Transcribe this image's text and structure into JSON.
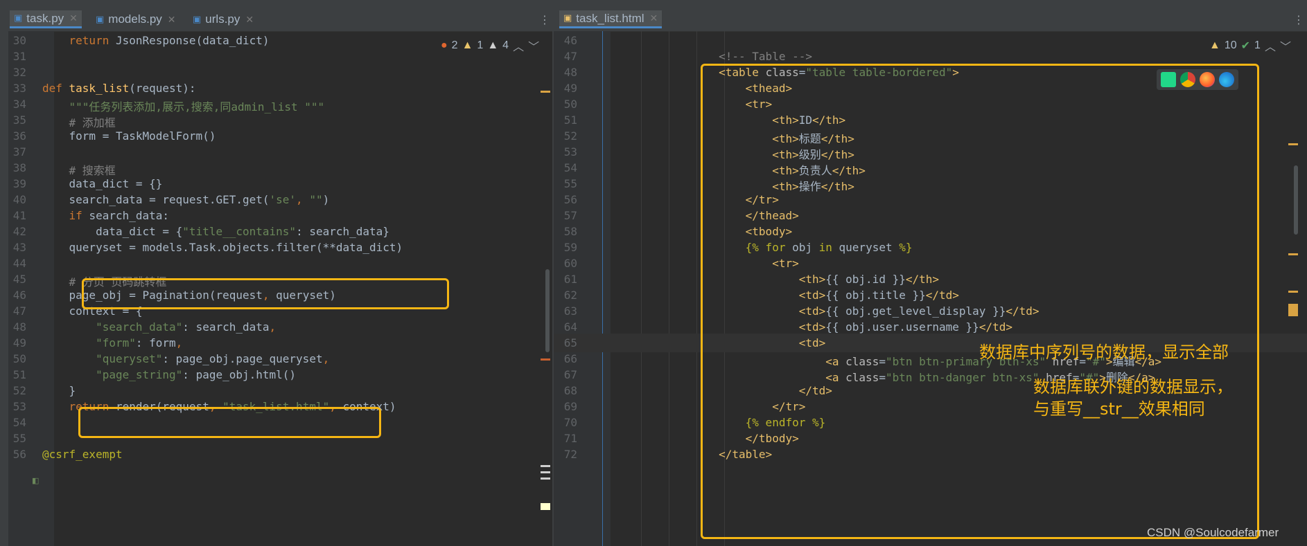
{
  "left_editor": {
    "tabs": [
      {
        "label": "task.py",
        "active": true,
        "icon": "python-file-icon"
      },
      {
        "label": "models.py",
        "active": false,
        "icon": "python-file-icon"
      },
      {
        "label": "urls.py",
        "active": false,
        "icon": "python-file-icon"
      }
    ],
    "inspection": {
      "errors": "2",
      "warnings": "1",
      "weak_warnings": "4"
    },
    "lines": [
      {
        "n": "30",
        "tokens": [
          [
            "k",
            "    return "
          ],
          [
            "",
            "JsonResponse(data_dict)"
          ]
        ]
      },
      {
        "n": "31",
        "tokens": []
      },
      {
        "n": "32",
        "tokens": []
      },
      {
        "n": "33",
        "tokens": [
          [
            "k",
            "def "
          ],
          [
            "f",
            "task_list"
          ],
          [
            "",
            "(request):"
          ]
        ]
      },
      {
        "n": "34",
        "tokens": [
          [
            "s",
            "    \"\"\"任务列表添加,展示,搜索,同admin_list \"\"\""
          ]
        ]
      },
      {
        "n": "35",
        "tokens": [
          [
            "c",
            "    # 添加框"
          ]
        ]
      },
      {
        "n": "36",
        "tokens": [
          [
            "",
            "    form = TaskModelForm()"
          ]
        ]
      },
      {
        "n": "37",
        "tokens": []
      },
      {
        "n": "38",
        "tokens": [
          [
            "c",
            "    # 搜索框"
          ]
        ]
      },
      {
        "n": "39",
        "tokens": [
          [
            "",
            "    data_dict = {}"
          ]
        ]
      },
      {
        "n": "40",
        "tokens": [
          [
            "",
            "    search_data = request.GET.get("
          ],
          [
            "s",
            "'se'"
          ],
          [
            "k",
            ", "
          ],
          [
            "s",
            "\"\""
          ],
          [
            "",
            ")"
          ]
        ]
      },
      {
        "n": "41",
        "tokens": [
          [
            "k",
            "    if "
          ],
          [
            "",
            "search_data:"
          ]
        ]
      },
      {
        "n": "42",
        "tokens": [
          [
            "",
            "        data_dict = {"
          ],
          [
            "s",
            "\"title__contains\""
          ],
          [
            "",
            ": search_data}"
          ]
        ]
      },
      {
        "n": "43",
        "tokens": [
          [
            "",
            "    queryset = models.Task.objects.filter(**data_dict)"
          ]
        ]
      },
      {
        "n": "44",
        "tokens": []
      },
      {
        "n": "45",
        "tokens": [
          [
            "c",
            "    # 分页 页码跳转框"
          ]
        ]
      },
      {
        "n": "46",
        "tokens": [
          [
            "",
            "    page_obj = Pagination(request"
          ],
          [
            "k",
            ", "
          ],
          [
            "",
            "queryset)"
          ]
        ]
      },
      {
        "n": "47",
        "tokens": [
          [
            "",
            "    context = {"
          ]
        ]
      },
      {
        "n": "48",
        "tokens": [
          [
            "s",
            "        \"search_data\""
          ],
          [
            "",
            ": search_data"
          ],
          [
            "k",
            ","
          ]
        ]
      },
      {
        "n": "49",
        "tokens": [
          [
            "s",
            "        \"form\""
          ],
          [
            "",
            ": form"
          ],
          [
            "k",
            ","
          ]
        ]
      },
      {
        "n": "50",
        "tokens": [
          [
            "s",
            "        \"queryset\""
          ],
          [
            "",
            ": page_obj.page_queryset"
          ],
          [
            "k",
            ","
          ]
        ]
      },
      {
        "n": "51",
        "tokens": [
          [
            "s",
            "        \"page_string\""
          ],
          [
            "",
            ": page_obj.html()"
          ]
        ]
      },
      {
        "n": "52",
        "tokens": [
          [
            "",
            "    }"
          ]
        ]
      },
      {
        "n": "53",
        "tokens": [
          [
            "k",
            "    return "
          ],
          [
            "",
            "render(request"
          ],
          [
            "k",
            ", "
          ],
          [
            "s",
            "\"task_list.html\""
          ],
          [
            "k",
            ", "
          ],
          [
            "",
            "context)"
          ]
        ]
      },
      {
        "n": "54",
        "tokens": []
      },
      {
        "n": "55",
        "tokens": []
      },
      {
        "n": "56",
        "tokens": [
          [
            "d",
            "@csrf_exempt"
          ]
        ]
      }
    ]
  },
  "right_editor": {
    "tabs": [
      {
        "label": "task_list.html",
        "active": true,
        "icon": "html-file-icon"
      }
    ],
    "inspection": {
      "warnings": "10",
      "typos": "1"
    },
    "lines": [
      {
        "n": "46",
        "tokens": []
      },
      {
        "n": "47",
        "tokens": [
          [
            "c",
            "                <!-- Table -->"
          ]
        ]
      },
      {
        "n": "48",
        "tokens": [
          [
            "tg",
            "                <table "
          ],
          [
            "at",
            "class"
          ],
          [
            "",
            "="
          ],
          [
            "av",
            "\"table table-bordered\""
          ],
          [
            "tg",
            ">"
          ]
        ]
      },
      {
        "n": "49",
        "tokens": [
          [
            "tg",
            "                    <thead>"
          ]
        ]
      },
      {
        "n": "50",
        "tokens": [
          [
            "tg",
            "                    <tr>"
          ]
        ]
      },
      {
        "n": "51",
        "tokens": [
          [
            "tg",
            "                        <th>"
          ],
          [
            "",
            "ID"
          ],
          [
            "tg",
            "</th>"
          ]
        ]
      },
      {
        "n": "52",
        "tokens": [
          [
            "tg",
            "                        <th>"
          ],
          [
            "",
            "标题"
          ],
          [
            "tg",
            "</th>"
          ]
        ]
      },
      {
        "n": "53",
        "tokens": [
          [
            "tg",
            "                        <th>"
          ],
          [
            "",
            "级别"
          ],
          [
            "tg",
            "</th>"
          ]
        ]
      },
      {
        "n": "54",
        "tokens": [
          [
            "tg",
            "                        <th>"
          ],
          [
            "",
            "负责人"
          ],
          [
            "tg",
            "</th>"
          ]
        ]
      },
      {
        "n": "55",
        "tokens": [
          [
            "tg",
            "                        <th>"
          ],
          [
            "",
            "操作"
          ],
          [
            "tg",
            "</th>"
          ]
        ]
      },
      {
        "n": "56",
        "tokens": [
          [
            "tg",
            "                    </tr>"
          ]
        ]
      },
      {
        "n": "57",
        "tokens": [
          [
            "tg",
            "                    </thead>"
          ]
        ]
      },
      {
        "n": "58",
        "tokens": [
          [
            "tg",
            "                    <tbody>"
          ]
        ]
      },
      {
        "n": "59",
        "tokens": [
          [
            "d",
            "                    {% for "
          ],
          [
            "",
            "obj "
          ],
          [
            "d",
            "in "
          ],
          [
            "",
            "queryset "
          ],
          [
            "d",
            "%}"
          ]
        ]
      },
      {
        "n": "60",
        "tokens": [
          [
            "tg",
            "                        <tr>"
          ]
        ]
      },
      {
        "n": "61",
        "tokens": [
          [
            "tg",
            "                            <th>"
          ],
          [
            "",
            "{{ obj.id }}"
          ],
          [
            "tg",
            "</th>"
          ]
        ]
      },
      {
        "n": "62",
        "tokens": [
          [
            "tg",
            "                            <td>"
          ],
          [
            "",
            "{{ obj.title }}"
          ],
          [
            "tg",
            "</td>"
          ]
        ]
      },
      {
        "n": "63",
        "tokens": [
          [
            "tg",
            "                            <td>"
          ],
          [
            "",
            "{{ obj.get_level_display }}"
          ],
          [
            "tg",
            "</td>"
          ]
        ]
      },
      {
        "n": "64",
        "tokens": [
          [
            "tg",
            "                            <td>"
          ],
          [
            "",
            "{{ obj.user.username }}"
          ],
          [
            "tg",
            "</td>"
          ]
        ]
      },
      {
        "n": "65",
        "tokens": [
          [
            "tg",
            "                            <td>"
          ]
        ]
      },
      {
        "n": "66",
        "tokens": [
          [
            "tg",
            "                                <a "
          ],
          [
            "at",
            "class"
          ],
          [
            "",
            "="
          ],
          [
            "av",
            "\"btn btn-primary btn-xs\" "
          ],
          [
            "at",
            "href"
          ],
          [
            "",
            "="
          ],
          [
            "av",
            "\"#\""
          ],
          [
            "tg",
            ">"
          ],
          [
            "",
            "编辑"
          ],
          [
            "tg",
            "</a>"
          ]
        ]
      },
      {
        "n": "67",
        "tokens": [
          [
            "tg",
            "                                <a "
          ],
          [
            "at",
            "class"
          ],
          [
            "",
            "="
          ],
          [
            "av",
            "\"btn btn-danger btn-xs\" "
          ],
          [
            "at",
            "href"
          ],
          [
            "",
            "="
          ],
          [
            "av",
            "\"#\""
          ],
          [
            "tg",
            ">"
          ],
          [
            "",
            "删除"
          ],
          [
            "tg",
            "</a>"
          ]
        ]
      },
      {
        "n": "68",
        "tokens": [
          [
            "tg",
            "                            </td>"
          ]
        ]
      },
      {
        "n": "69",
        "tokens": [
          [
            "tg",
            "                        </tr>"
          ]
        ]
      },
      {
        "n": "70",
        "tokens": [
          [
            "d",
            "                    {% endfor %}"
          ]
        ]
      },
      {
        "n": "71",
        "tokens": [
          [
            "tg",
            "                    </tbody>"
          ]
        ]
      },
      {
        "n": "72",
        "tokens": [
          [
            "tg",
            "                </table>"
          ]
        ]
      }
    ]
  },
  "annotations": {
    "anno1": "数据库中序列号的数据，显示全部",
    "anno2_line1": "数据库联外键的数据显示，",
    "anno2_line2": "与重写__str__效果相同"
  },
  "watermark": "CSDN @Soulcodefarmer",
  "colors": {
    "accent": "#f5b614",
    "background": "#2b2b2b",
    "keyword": "#cc7832",
    "string": "#6a8759",
    "tag": "#e8bf6a"
  }
}
